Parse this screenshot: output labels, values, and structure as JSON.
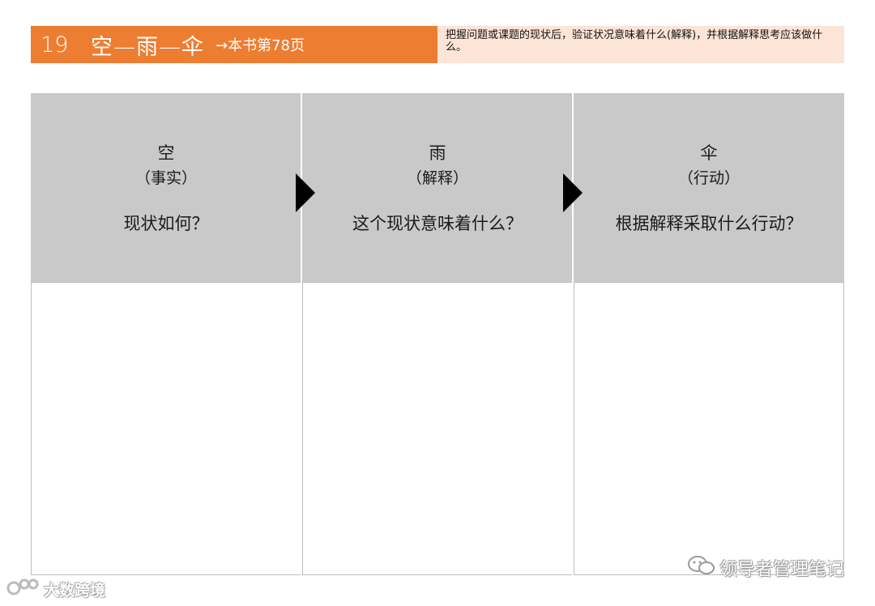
{
  "header": {
    "number": "19",
    "title": "空—雨—伞",
    "reference": "→本书第78页",
    "description": "把握问题或课题的现状后，验证状况意味着什么(解释)，并根据解释思考应该做什么。"
  },
  "columns": [
    {
      "char": "空",
      "sub": "（事实）",
      "question": "现状如何？"
    },
    {
      "char": "雨",
      "sub": "（解释）",
      "question": "这个现状意味着什么？"
    },
    {
      "char": "伞",
      "sub": "（行动）",
      "question": "根据解释采取什么行动？"
    }
  ],
  "watermarks": {
    "left": "大数跨境",
    "right": "领导者管理笔记"
  },
  "colors": {
    "header_orange": "#ED7D31",
    "header_peach": "#FCE4D6",
    "column_head_gray": "#C9C9C9"
  }
}
